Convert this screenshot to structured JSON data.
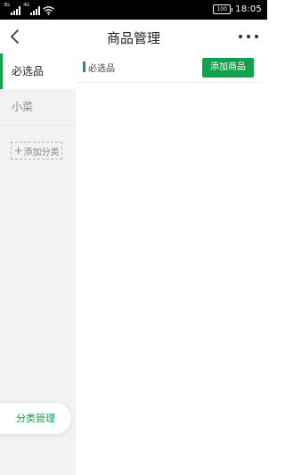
{
  "status_bar": {
    "net_tag_1": "3G",
    "net_tag_2": "4G",
    "battery": "100",
    "time": "18:05"
  },
  "nav": {
    "title": "商品管理",
    "back_icon": "chevron-left-icon",
    "more_icon": "more-dots-icon"
  },
  "sidebar": {
    "categories": [
      {
        "label": "必选品",
        "active": true
      },
      {
        "label": "小菜",
        "active": false
      }
    ],
    "add_category_label": "添加分类",
    "manage_label": "分类管理"
  },
  "main": {
    "section_title": "必选品",
    "add_product_label": "添加商品"
  },
  "colors": {
    "accent": "#11a24e",
    "sidebar_bg": "#f2f2f2",
    "status_bar_bg": "#000000"
  }
}
